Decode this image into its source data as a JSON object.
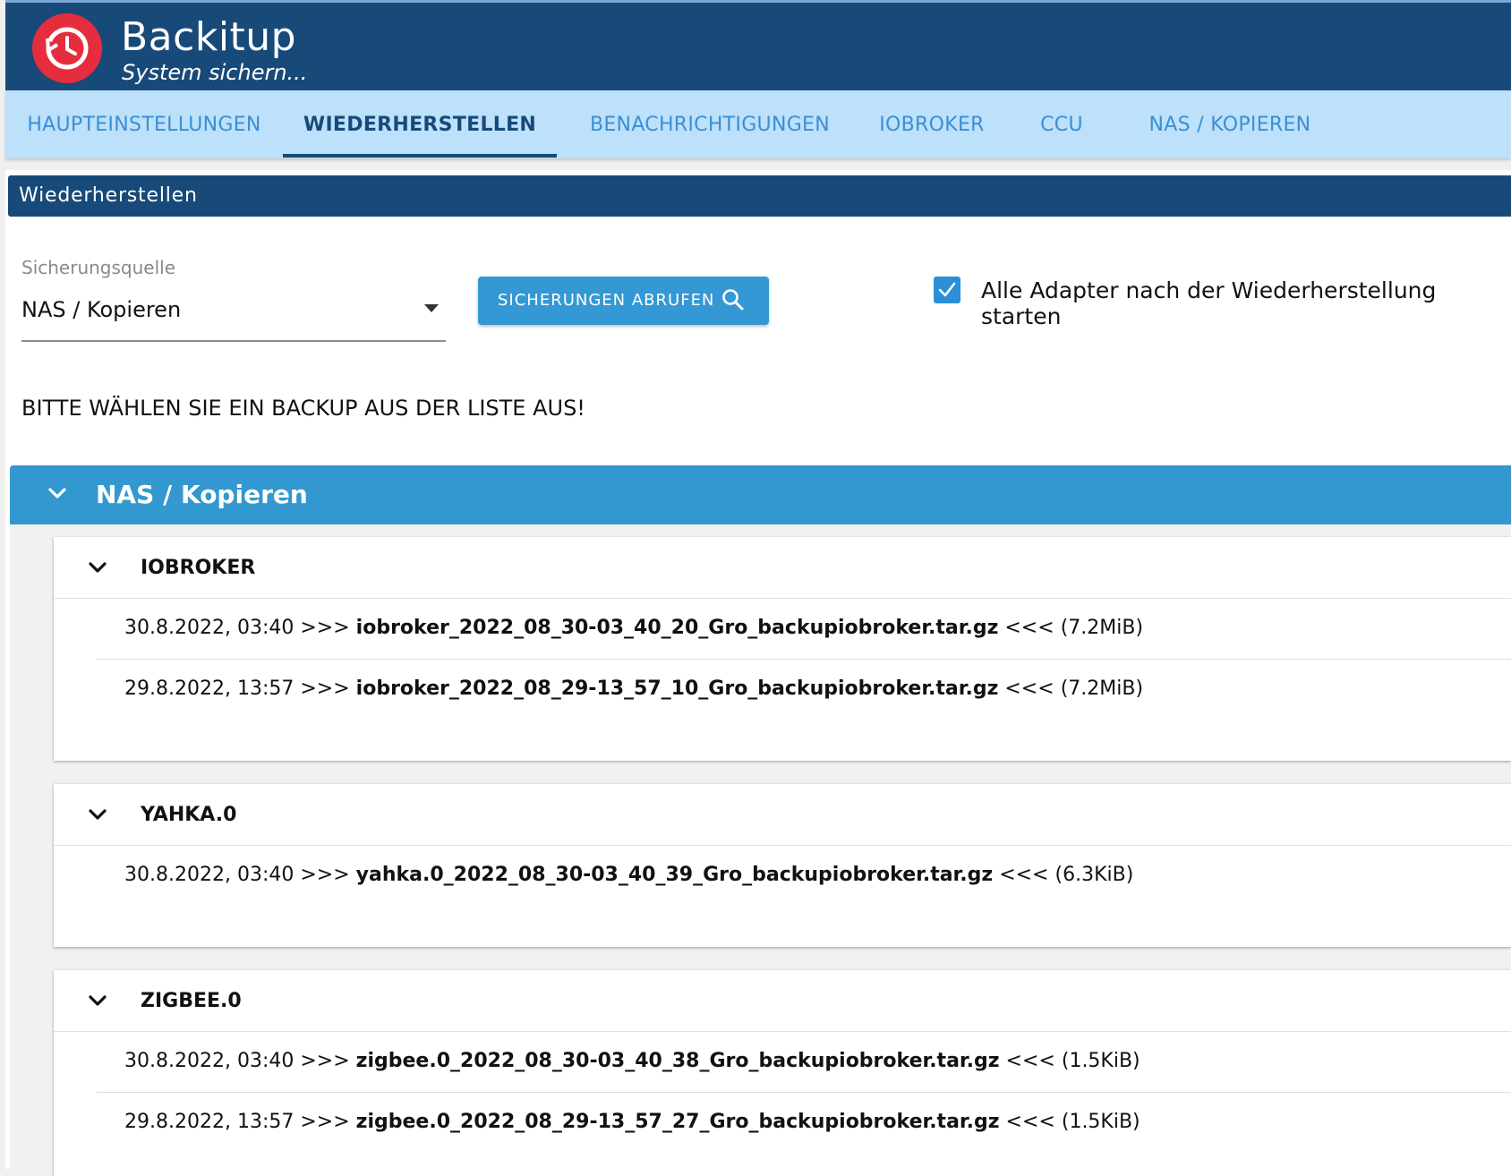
{
  "header": {
    "title": "Backitup",
    "subtitle": "System sichern...",
    "logo_icon": "backup-clock-icon",
    "brand_color": "#174a78",
    "logo_color": "#e62d3e"
  },
  "tabs": [
    {
      "label": "HAUPTEINSTELLUNGEN"
    },
    {
      "label": "WIEDERHERSTELLEN"
    },
    {
      "label": "BENACHRICHTIGUNGEN"
    },
    {
      "label": "IOBROKER"
    },
    {
      "label": "CCU"
    },
    {
      "label": "NAS / KOPIEREN"
    }
  ],
  "active_tab": "WIEDERHERSTELLEN",
  "section": {
    "title": "Wiederherstellen"
  },
  "source_select": {
    "label": "Sicherungsquelle",
    "value": "NAS / Kopieren"
  },
  "fetch_button": {
    "label": "SICHERUNGEN ABRUFEN",
    "icon": "search-icon"
  },
  "start_adapters": {
    "checked": true,
    "label": "Alle Adapter nach der Wiederherstellung starten"
  },
  "instruction": "BITTE WÄHLEN SIE EIN BACKUP AUS DER LISTE AUS!",
  "backup_list": {
    "title": "NAS / Kopieren",
    "groups": [
      {
        "name": "IOBROKER",
        "entries": [
          {
            "date": "30.8.2022, 03:40",
            "prefix": ">>>",
            "file": "iobroker_2022_08_30-03_40_20_Gro_backupiobroker.tar.gz",
            "suffix": "<<<",
            "size": "(7.2MiB)"
          },
          {
            "date": "29.8.2022, 13:57",
            "prefix": ">>>",
            "file": "iobroker_2022_08_29-13_57_10_Gro_backupiobroker.tar.gz",
            "suffix": "<<<",
            "size": "(7.2MiB)"
          }
        ]
      },
      {
        "name": "YAHKA.0",
        "entries": [
          {
            "date": "30.8.2022, 03:40",
            "prefix": ">>>",
            "file": "yahka.0_2022_08_30-03_40_39_Gro_backupiobroker.tar.gz",
            "suffix": "<<<",
            "size": "(6.3KiB)"
          }
        ]
      },
      {
        "name": "ZIGBEE.0",
        "entries": [
          {
            "date": "30.8.2022, 03:40",
            "prefix": ">>>",
            "file": "zigbee.0_2022_08_30-03_40_38_Gro_backupiobroker.tar.gz",
            "suffix": "<<<",
            "size": "(1.5KiB)"
          },
          {
            "date": "29.8.2022, 13:57",
            "prefix": ">>>",
            "file": "zigbee.0_2022_08_29-13_57_27_Gro_backupiobroker.tar.gz",
            "suffix": "<<<",
            "size": "(1.5KiB)"
          }
        ]
      }
    ]
  }
}
